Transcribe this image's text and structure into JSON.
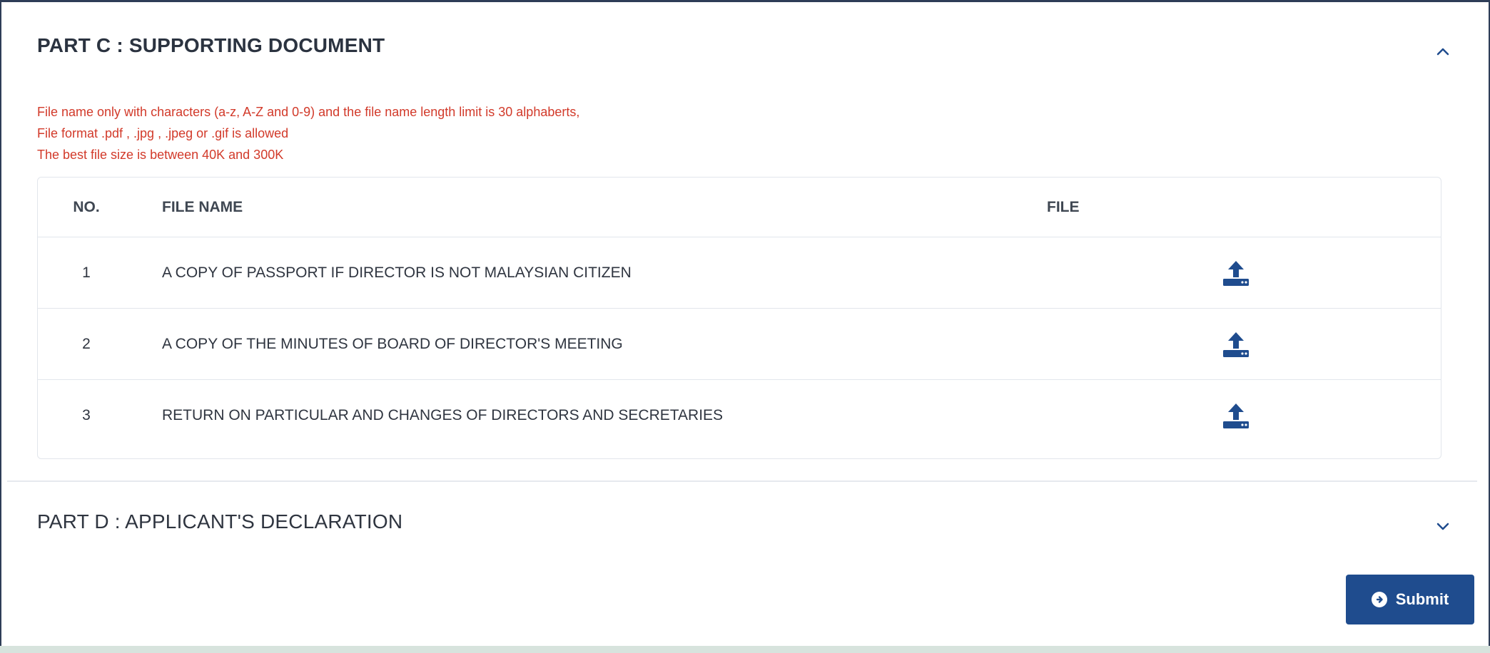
{
  "part_c": {
    "title": "PART C : SUPPORTING DOCUMENT",
    "toggle_icon": "chevron-up-icon",
    "notes": [
      "File name only with characters (a-z, A-Z and 0-9) and the file name length limit is 30 alphaberts,",
      "File format .pdf , .jpg , .jpeg or .gif is allowed",
      "The best file size is between 40K and 300K"
    ],
    "table": {
      "headers": {
        "no": "NO.",
        "file_name": "FILE NAME",
        "file": "FILE"
      },
      "rows": [
        {
          "no": "1",
          "file_name": "A COPY OF PASSPORT IF DIRECTOR IS NOT MALAYSIAN CITIZEN",
          "icon": "upload-icon"
        },
        {
          "no": "2",
          "file_name": "A COPY OF THE MINUTES OF BOARD OF DIRECTOR'S MEETING",
          "icon": "upload-icon"
        },
        {
          "no": "3",
          "file_name": "RETURN ON PARTICULAR AND CHANGES OF DIRECTORS AND SECRETARIES",
          "icon": "upload-icon"
        }
      ]
    }
  },
  "part_d": {
    "title": "PART D : APPLICANT'S DECLARATION",
    "toggle_icon": "chevron-down-icon"
  },
  "submit": {
    "label": "Submit",
    "icon": "arrow-circle-right-icon"
  },
  "colors": {
    "accent": "#1f4c8e",
    "note_text": "#d23a2a",
    "border": "#e2e6ec"
  }
}
